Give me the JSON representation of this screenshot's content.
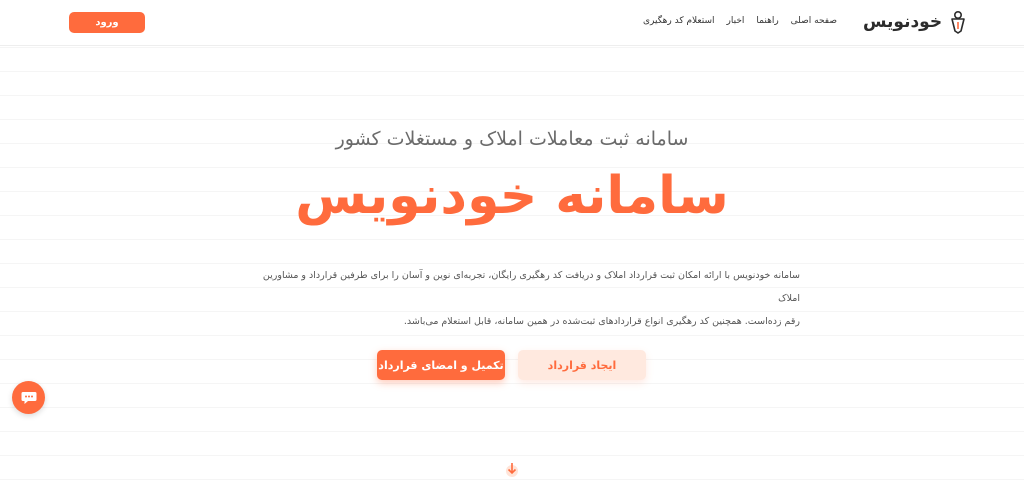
{
  "header": {
    "login_label": "ورود",
    "logo_text": "خودنویس",
    "nav": [
      "صفحه اصلی",
      "راهنما",
      "اخبار",
      "استعلام کد رهگیری"
    ]
  },
  "hero": {
    "subtitle": "سامانه ثبت معاملات املاک و مستغلات کشور",
    "title": "سامانه خودنویس",
    "description_line1": "سامانه خودنویس با ارائه امکان ثبت قرارداد املاک و دریافت کد رهگیری رایگان، تجربه‌ای نوین و آسان را برای طرفین قرارداد و مشاورین املاک",
    "description_line2": "رقم زده‌است. همچنین کد رهگیری انواع قراردادهای ثبت‌شده در همین سامانه، قابل استعلام می‌باشد.",
    "btn_create": "ایجاد قرارداد",
    "btn_sign": "تکمیل و امضای قرارداد"
  },
  "colors": {
    "accent": "#ff6b3d",
    "accent_light": "#ffe9df",
    "text": "#333333"
  },
  "icons": {
    "logo": "pen-nib-icon",
    "chat": "chat-bubble-icon",
    "scroll": "arrow-down-icon"
  }
}
